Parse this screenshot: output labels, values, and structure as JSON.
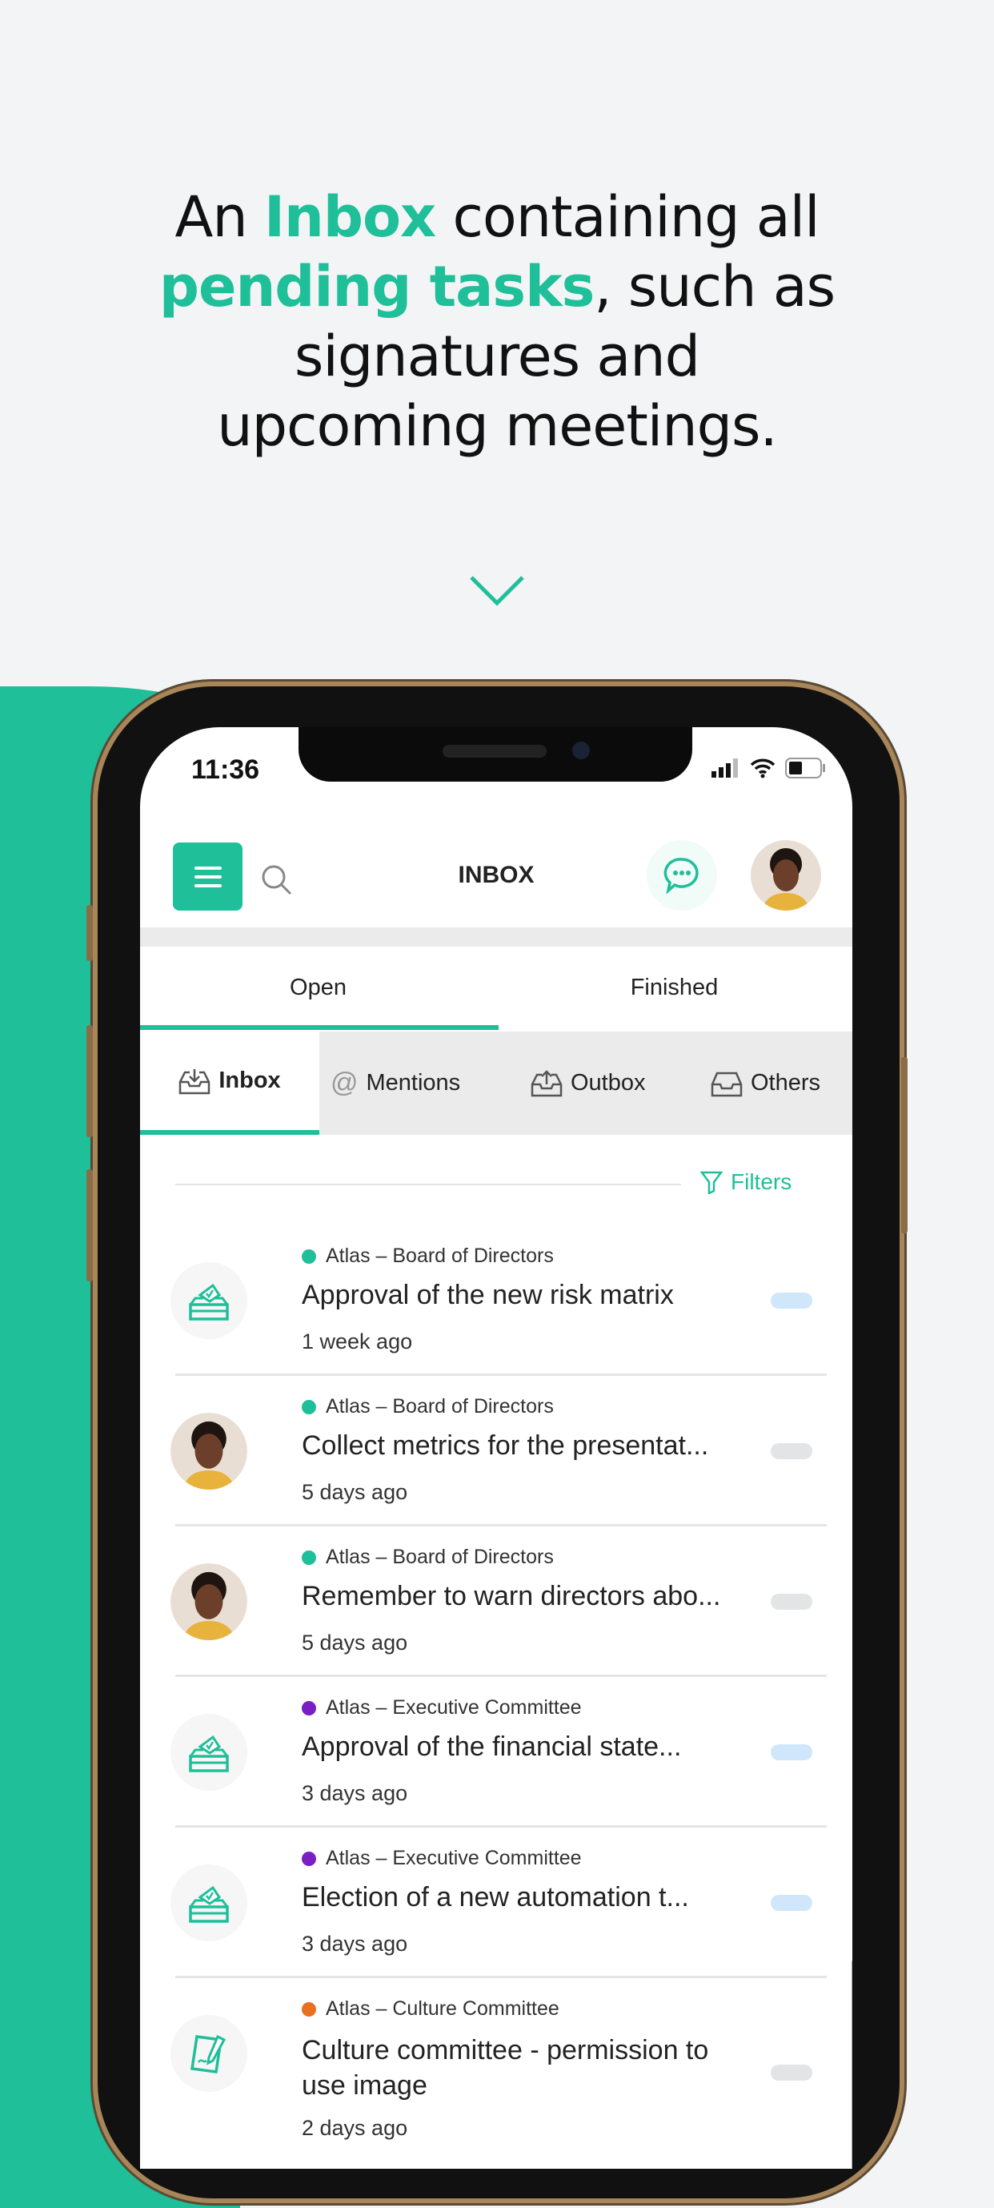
{
  "headline": {
    "l1a": "An ",
    "l1b": "Inbox",
    "l1c": " containing all",
    "l2a": "pending tasks",
    "l2b": ", such as",
    "l3": "signatures and",
    "l4": "upcoming meetings."
  },
  "accent": "#1fbf9a",
  "status_bar": {
    "time": "11:36"
  },
  "header": {
    "title": "INBOX",
    "menu_icon": "hamburger-icon",
    "search_icon": "search-icon",
    "chat_icon": "chat-bubble-icon"
  },
  "tabs": [
    {
      "label": "Open",
      "active": true
    },
    {
      "label": "Finished",
      "active": false
    }
  ],
  "subtabs": [
    {
      "label": "Inbox",
      "icon": "inbox-download-icon",
      "active": true
    },
    {
      "label": "Mentions",
      "icon": "at-icon"
    },
    {
      "label": "Outbox",
      "icon": "outbox-upload-icon"
    },
    {
      "label": "Others",
      "icon": "tray-icon"
    }
  ],
  "filters": {
    "label": "Filters",
    "icon": "filter-icon"
  },
  "items": [
    {
      "group": "Atlas – Board of Directors",
      "dot": "#1fbf9a",
      "title": "Approval of the new risk matrix",
      "time": "1 week ago",
      "icon": "ballot-box-icon",
      "pill": "#cfe6fb"
    },
    {
      "group": "Atlas – Board of Directors",
      "dot": "#1fbf9a",
      "title": "Collect metrics for the presentat...",
      "time": "5 days ago",
      "icon": "avatar",
      "pill": "#e3e4e6"
    },
    {
      "group": "Atlas – Board of Directors",
      "dot": "#1fbf9a",
      "title": "Remember to warn directors abo...",
      "time": "5 days ago",
      "icon": "avatar",
      "pill": "#e3e4e6"
    },
    {
      "group": "Atlas – Executive Committee",
      "dot": "#7a1fc4",
      "title": "Approval of the financial state...",
      "time": "3 days ago",
      "icon": "ballot-box-icon",
      "pill": "#cfe6fb"
    },
    {
      "group": "Atlas – Executive Committee",
      "dot": "#7a1fc4",
      "title": "Election of a new automation t...",
      "time": "3 days ago",
      "icon": "ballot-box-icon",
      "pill": "#cfe6fb"
    },
    {
      "group": "Atlas – Culture Committee",
      "dot": "#e8701e",
      "title": "Culture committee - permission to use image",
      "time": "2 days ago",
      "icon": "signature-document-icon",
      "pill": "#e3e4e6"
    }
  ]
}
